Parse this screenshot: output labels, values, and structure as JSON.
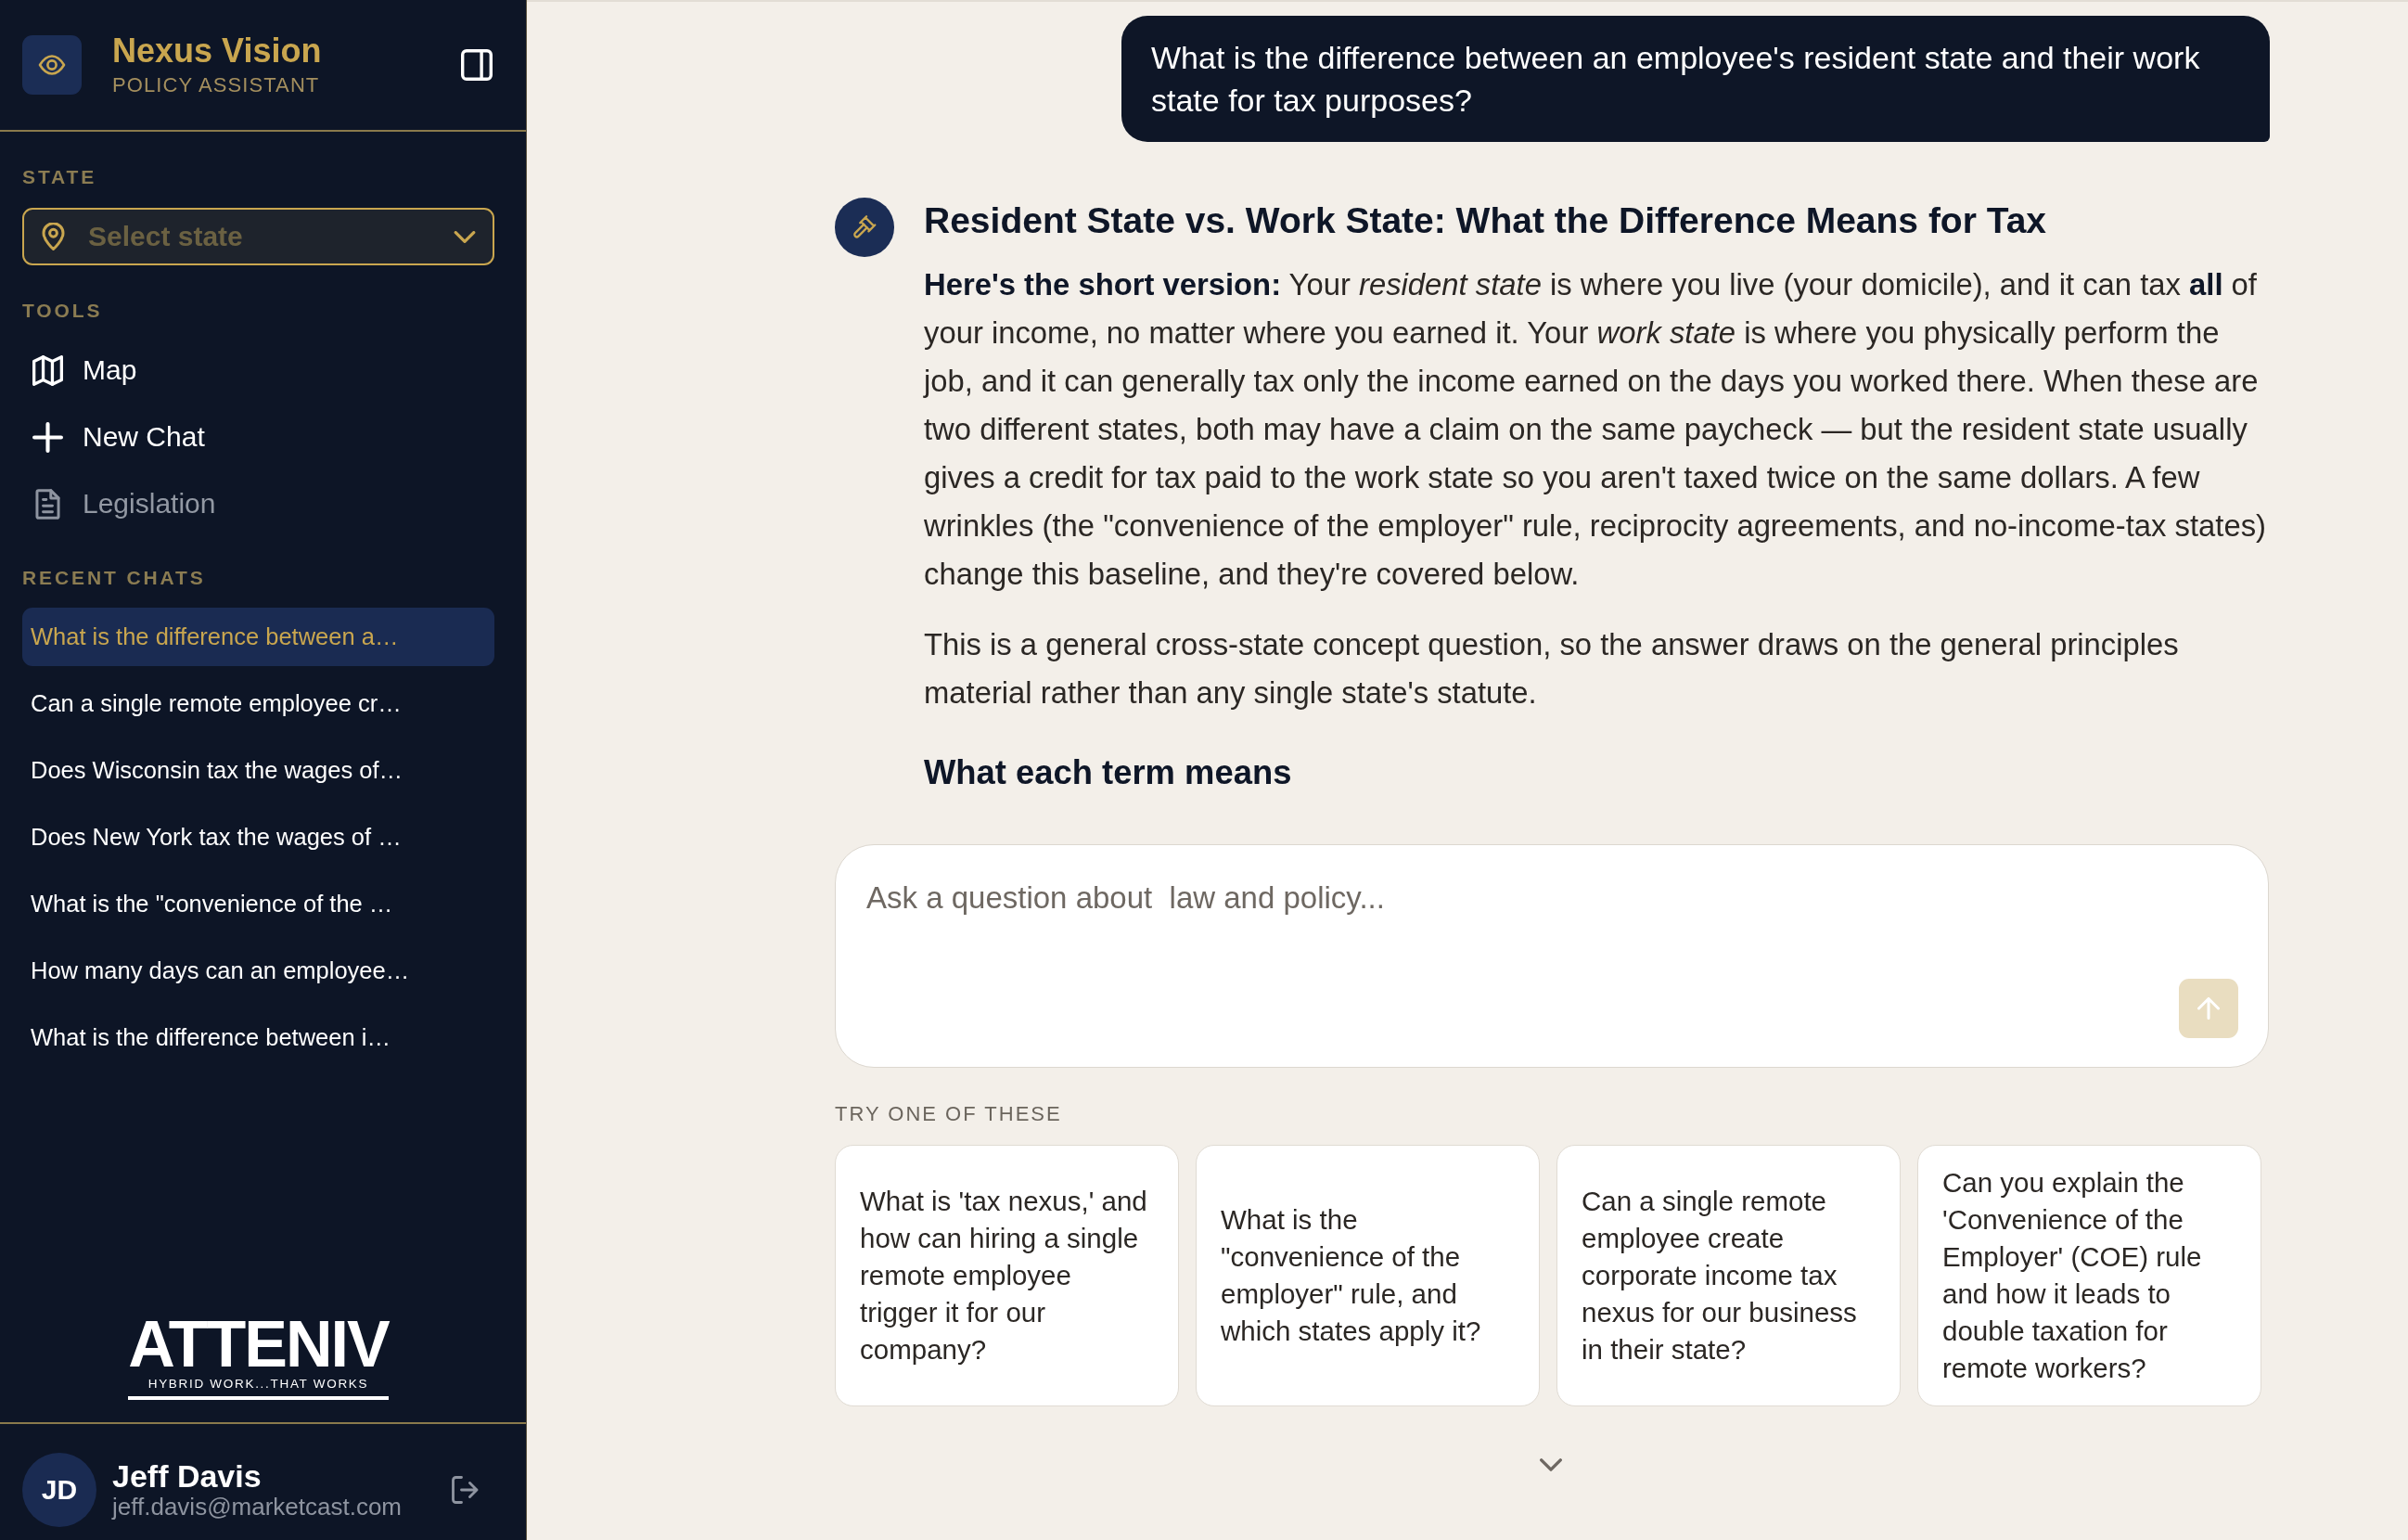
{
  "sidebar": {
    "brand": {
      "title": "Nexus Vision",
      "subtitle": "POLICY ASSISTANT"
    },
    "state_section": {
      "label": "STATE",
      "select": {
        "placeholder": "Select state"
      }
    },
    "tools_section": {
      "label": "TOOLS",
      "items": [
        {
          "kind": "map",
          "label": "Map",
          "disabled": false
        },
        {
          "kind": "add",
          "label": "New Chat",
          "disabled": false
        },
        {
          "kind": "document",
          "label": "Legislation",
          "disabled": true
        }
      ]
    },
    "recent_chats": {
      "label": "RECENT CHATS",
      "items": [
        {
          "title": "What is the difference between a…",
          "selected": true
        },
        {
          "title": "Can a single remote employee cr…",
          "selected": false
        },
        {
          "title": "Does Wisconsin tax the wages of…",
          "selected": false
        },
        {
          "title": "Does New York tax the wages of …",
          "selected": false
        },
        {
          "title": "What is the \"convenience of the …",
          "selected": false
        },
        {
          "title": "How many days can an employee…",
          "selected": false
        },
        {
          "title": "What is the difference between i…",
          "selected": false
        }
      ]
    },
    "partner_logo": {
      "wordmark": "ATTENIV",
      "tagline": "HYBRID WORK...THAT WORKS"
    },
    "user": {
      "initials": "JD",
      "name": "Jeff Davis",
      "email": "jeff.davis@marketcast.com"
    }
  },
  "conversation": {
    "messages": [
      {
        "kind": "question",
        "text": "What is the difference between an employee's resident state and their work state for tax purposes?"
      },
      {
        "kind": "answer",
        "blocks": [
          {
            "kind": "heading",
            "text": "Resident State vs. Work State: What the Difference Means for Tax"
          },
          {
            "kind": "paragraph",
            "text": "**Here's the short version:** Your *resident state* is where you live (your domicile), and it can tax **all** of your income, no matter where you earned it. Your *work state* is where you physically perform the job, and it can generally tax only the income earned on the days you worked there. When these are two different states, both may have a claim on the same paycheck — but the resident state usually gives a credit for tax paid to the work state so you aren't taxed twice on the same dollars. A few wrinkles (the \"convenience of the employer\" rule, reciprocity agreements, and no-income-tax states) change this baseline, and they're covered below."
          },
          {
            "kind": "paragraph",
            "text": "This is a general cross-state concept question, so the answer draws on the general principles material rather than any single state's statute."
          },
          {
            "kind": "subheading",
            "text": "What each term means"
          }
        ]
      }
    ]
  },
  "composer": {
    "placeholder": "Ask a question about  law and policy..."
  },
  "suggestions": {
    "label": "TRY ONE OF THESE",
    "items": [
      "What is 'tax nexus,' and how can hiring a single remote employee trigger it for our company?",
      "What is the \"convenience of the employer\" rule, and which states apply it?",
      "Can a single remote employee create corporate income tax nexus for our business in their state?",
      "Can you explain the 'Convenience of the Employer' (COE) rule and how it leads to double taxation for remote workers?"
    ]
  }
}
